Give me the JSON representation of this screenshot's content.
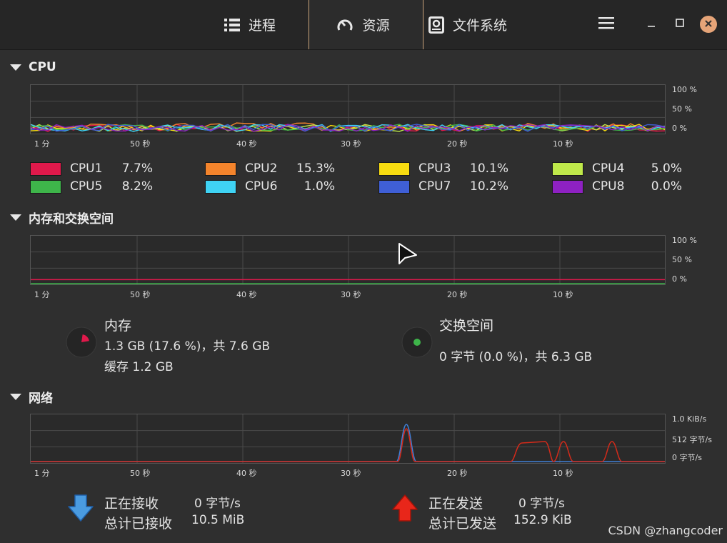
{
  "tabs": [
    {
      "label": "进程",
      "icon": "list-icon"
    },
    {
      "label": "资源",
      "icon": "gauge-icon"
    },
    {
      "label": "文件系统",
      "icon": "disk-icon"
    }
  ],
  "sections": {
    "cpu": "CPU",
    "memory": "内存和交换空间",
    "network": "网络"
  },
  "x_ticks": [
    "1 分",
    "50 秒",
    "40 秒",
    "30 秒",
    "20 秒",
    "10 秒"
  ],
  "y_ticks_percent": [
    "100 %",
    "50 %",
    "0 %"
  ],
  "y_ticks_network": [
    "1.0 KiB/s",
    "512 字节/s",
    "0 字节/s"
  ],
  "cpu_legend": [
    {
      "name": "CPU1",
      "value": "7.7%",
      "color": "#e0194b"
    },
    {
      "name": "CPU2",
      "value": "15.3%",
      "color": "#f4842c"
    },
    {
      "name": "CPU3",
      "value": "10.1%",
      "color": "#f8dc10"
    },
    {
      "name": "CPU4",
      "value": "5.0%",
      "color": "#bfe94a"
    },
    {
      "name": "CPU5",
      "value": "8.2%",
      "color": "#3eb54a"
    },
    {
      "name": "CPU6",
      "value": "1.0%",
      "color": "#3fd3f4"
    },
    {
      "name": "CPU7",
      "value": "10.2%",
      "color": "#3f5fd6"
    },
    {
      "name": "CPU8",
      "value": "0.0%",
      "color": "#8e21c2"
    }
  ],
  "memory": {
    "title": "内存",
    "usage": "1.3 GB (17.6 %)，共 7.6 GB",
    "cache": "缓存 1.2 GB",
    "color": "#e0194b",
    "fraction": 0.176
  },
  "swap": {
    "title": "交换空间",
    "usage": "0 字节 (0.0 %)，共 6.3 GB",
    "color": "#3eb54a"
  },
  "network": {
    "receiving_label": "正在接收",
    "receiving_value": "0 字节/s",
    "total_received_label": "总计已接收",
    "total_received_value": "10.5 MiB",
    "sending_label": "正在发送",
    "sending_value": "0 字节/s",
    "total_sent_label": "总计已发送",
    "total_sent_value": "152.9 KiB",
    "receive_color": "#3f7fd6",
    "send_color": "#d42a1a"
  },
  "watermark": "CSDN @zhangcoder"
}
